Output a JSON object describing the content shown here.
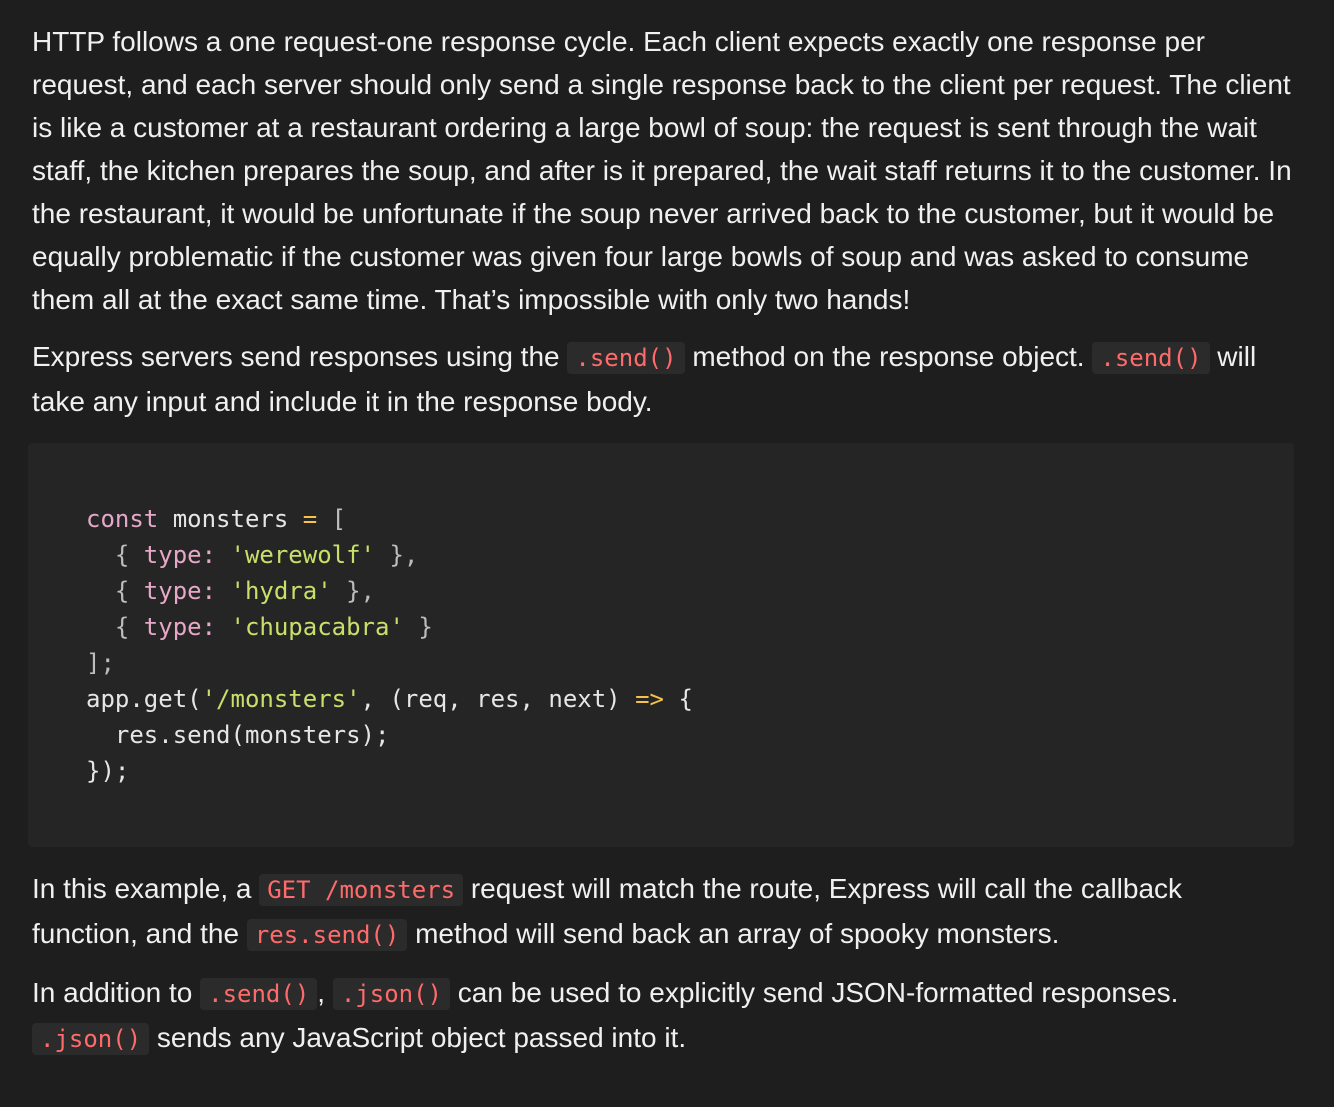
{
  "para1": "HTTP follows a one request-one response cycle. Each client expects exactly one response per request, and each server should only send a single response back to the client per request. The client is like a customer at a restaurant ordering a large bowl of soup: the request is sent through the wait staff, the kitchen prepares the soup, and after is it prepared, the wait staff returns it to the customer. In the restaurant, it would be unfortunate if the soup never arrived back to the customer, but it would be equally problematic if the customer was given four large bowls of soup and was asked to consume them all at the exact same time. That’s impossible with only two hands!",
  "para2": {
    "t1": "Express servers send responses using the ",
    "c1": ".send()",
    "t2": " method on the response object. ",
    "c2": ".send()",
    "t3": " will take any input and include it in the response body."
  },
  "code": {
    "l1": {
      "kw": "const",
      "name": " monsters ",
      "op": "=",
      "rest": " ["
    },
    "l2": {
      "open": "  { ",
      "prop": "type",
      "colon": ": ",
      "str": "'werewolf'",
      "close": " },"
    },
    "l3": {
      "open": "  { ",
      "prop": "type",
      "colon": ": ",
      "str": "'hydra'",
      "close": " },"
    },
    "l4": {
      "open": "  { ",
      "prop": "type",
      "colon": ": ",
      "str": "'chupacabra'",
      "close": " }"
    },
    "l5": "];",
    "l6": {
      "a": "app.get(",
      "str": "'/monsters'",
      "b": ", (req, res, next) ",
      "arrow": "=>",
      "c": " {"
    },
    "l7": "  res.send(monsters);",
    "l8": "});"
  },
  "para3": {
    "t1": "In this example, a ",
    "c1": "GET /monsters",
    "t2": " request will match the route, Express will call the callback function, and the ",
    "c2": "res.send()",
    "t3": " method will send back an array of spooky monsters."
  },
  "para4": {
    "t1": "In addition to ",
    "c1": ".send()",
    "t2": ", ",
    "c2": ".json()",
    "t3": " can be used to explicitly send JSON-formatted responses. ",
    "c3": ".json()",
    "t4": " sends any JavaScript object passed into it."
  }
}
